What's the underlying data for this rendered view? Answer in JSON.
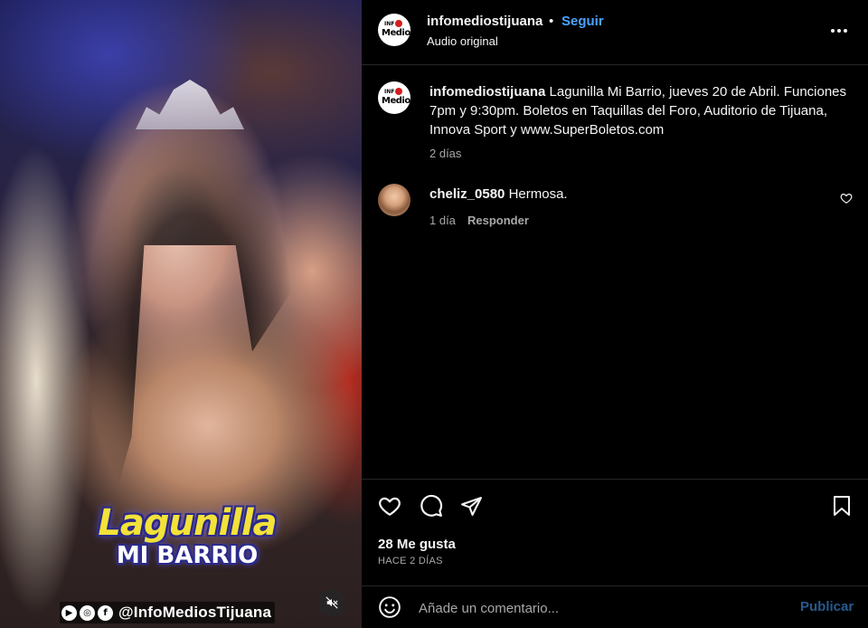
{
  "post": {
    "username": "infomediostijuana",
    "separator": "•",
    "follow_label": "Seguir",
    "audio_label": "Audio original",
    "avatar_logo_top": "INF",
    "avatar_logo_bottom": "Medios"
  },
  "media": {
    "logo_line1": "Lagunilla",
    "logo_line2": "MI BARRIO",
    "watermark_handle": "@InfoMediosTijuana",
    "watermark_icons": [
      "youtube-icon",
      "instagram-icon",
      "facebook-icon"
    ],
    "mute_icon": "speaker-muted-icon"
  },
  "caption": {
    "username": "infomediostijuana",
    "text": "Lagunilla Mi Barrio, jueves 20 de Abril. Funciones 7pm y 9:30pm. Boletos en Taquillas del Foro, Auditorio de Tijuana, Innova Sport y www.SuperBoletos.com",
    "time": "2 días"
  },
  "comments": [
    {
      "username": "cheliz_0580",
      "text": "Hermosa.",
      "time": "1 día",
      "reply_label": "Responder"
    }
  ],
  "actions": {
    "icons": [
      "heart-icon",
      "comment-icon",
      "share-icon",
      "bookmark-icon"
    ],
    "likes": "28 Me gusta",
    "post_age": "HACE 2 DÍAS"
  },
  "add_comment": {
    "placeholder": "Añade un comentario...",
    "publish_label": "Publicar"
  },
  "colors": {
    "background": "#000000",
    "text": "#f5f5f5",
    "secondary_text": "#a8a8a8",
    "accent": "#4aa3ff",
    "divider": "#262626"
  }
}
